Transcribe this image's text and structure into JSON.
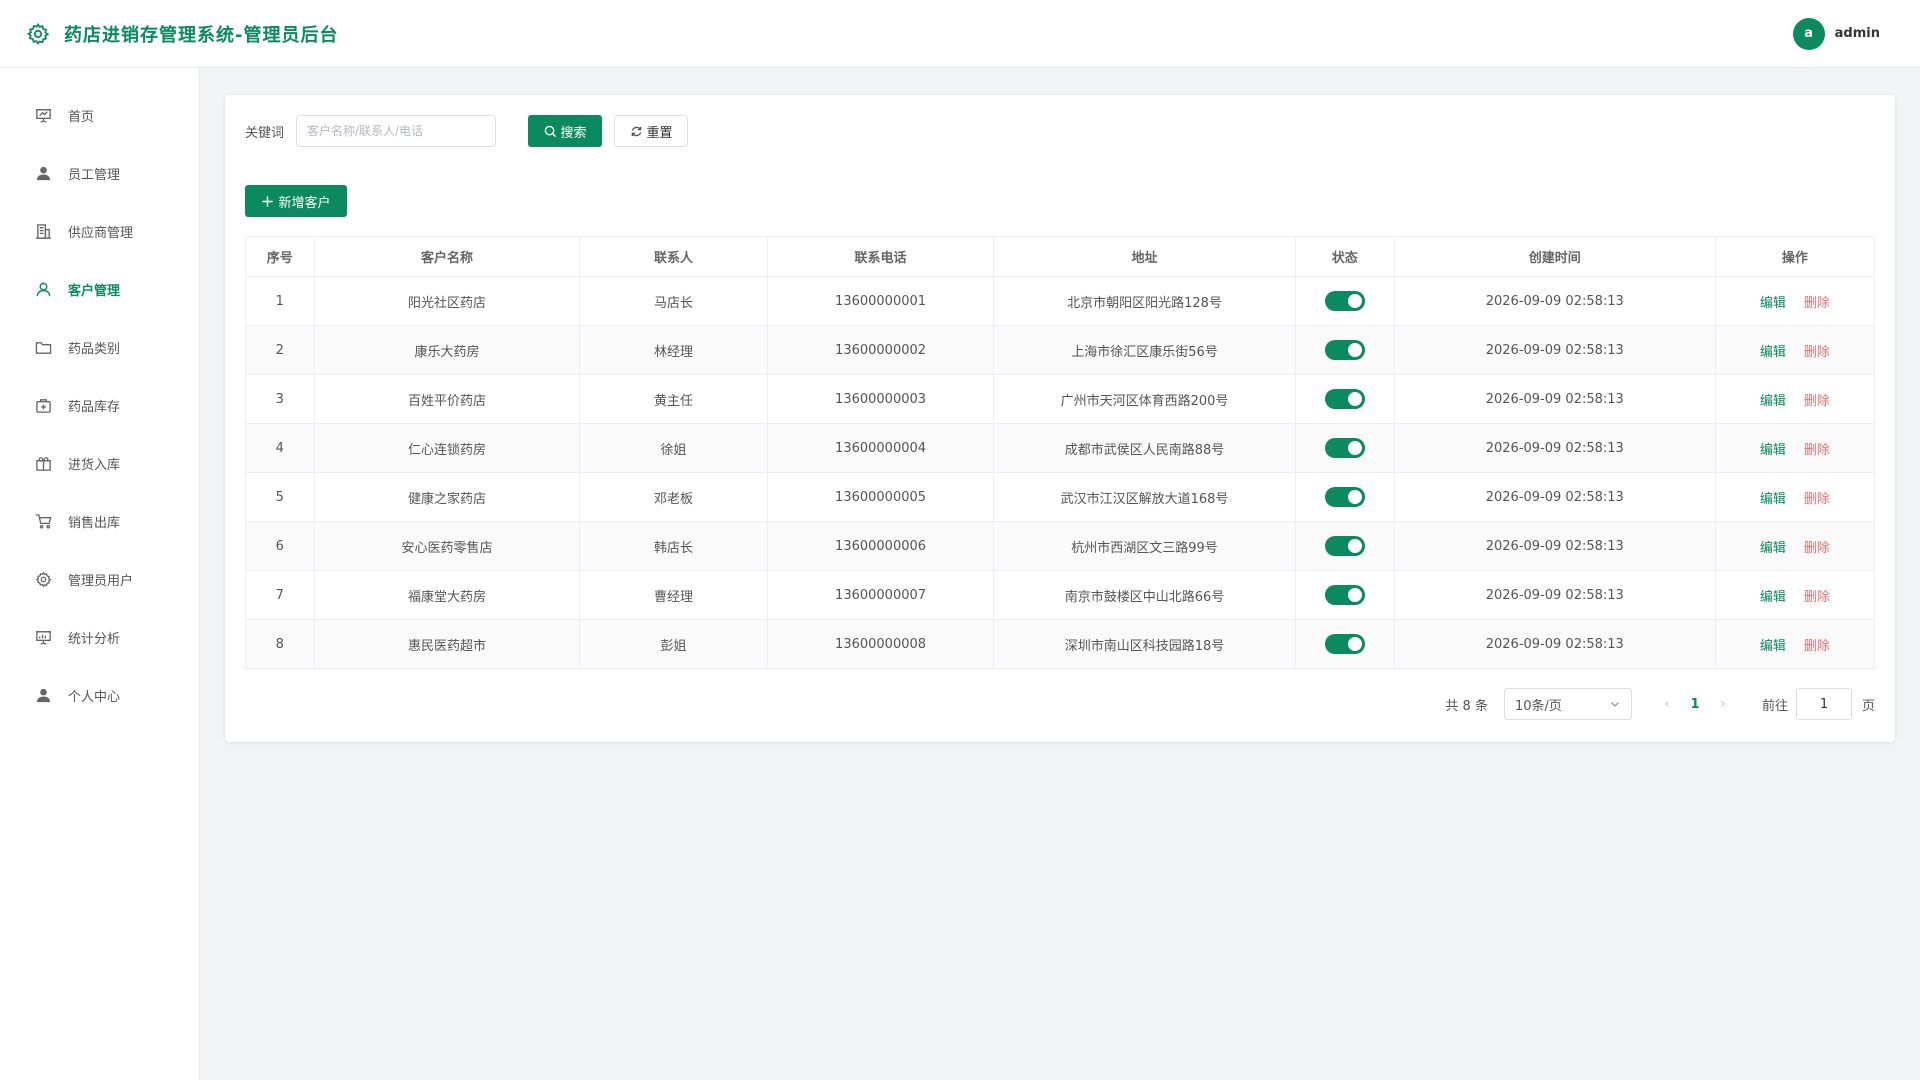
{
  "header": {
    "title": "药店进销存管理系统-管理员后台",
    "user": {
      "avatar_letter": "a",
      "name": "admin"
    }
  },
  "sidebar": {
    "items": [
      {
        "label": "首页",
        "icon": "presentation-icon",
        "active": false
      },
      {
        "label": "员工管理",
        "icon": "user-filled-icon",
        "active": false
      },
      {
        "label": "供应商管理",
        "icon": "office-building-icon",
        "active": false
      },
      {
        "label": "客户管理",
        "icon": "user-icon",
        "active": true
      },
      {
        "label": "药品类别",
        "icon": "folder-icon",
        "active": false
      },
      {
        "label": "药品库存",
        "icon": "first-aid-kit-icon",
        "active": false
      },
      {
        "label": "进货入库",
        "icon": "box-icon",
        "active": false
      },
      {
        "label": "销售出库",
        "icon": "shopping-cart-icon",
        "active": false
      },
      {
        "label": "管理员用户",
        "icon": "gear-icon",
        "active": false
      },
      {
        "label": "统计分析",
        "icon": "data-board-icon",
        "active": false
      },
      {
        "label": "个人中心",
        "icon": "user-filled-icon",
        "active": false
      }
    ]
  },
  "filters": {
    "keyword_label": "关键词",
    "keyword_placeholder": "客户名称/联系人/电话",
    "keyword_value": "",
    "search_label": "搜索",
    "reset_label": "重置"
  },
  "toolbar": {
    "add_label": "新增客户"
  },
  "table": {
    "columns": [
      "序号",
      "客户名称",
      "联系人",
      "联系电话",
      "地址",
      "状态",
      "创建时间",
      "操作"
    ],
    "edit_label": "编辑",
    "delete_label": "删除",
    "rows": [
      {
        "no": "1",
        "name": "阳光社区药店",
        "contact": "马店长",
        "phone": "13600000001",
        "address": "北京市朝阳区阳光路128号",
        "enabled": true,
        "created": "2026-09-09 02:58:13"
      },
      {
        "no": "2",
        "name": "康乐大药房",
        "contact": "林经理",
        "phone": "13600000002",
        "address": "上海市徐汇区康乐街56号",
        "enabled": true,
        "created": "2026-09-09 02:58:13"
      },
      {
        "no": "3",
        "name": "百姓平价药店",
        "contact": "黄主任",
        "phone": "13600000003",
        "address": "广州市天河区体育西路200号",
        "enabled": true,
        "created": "2026-09-09 02:58:13"
      },
      {
        "no": "4",
        "name": "仁心连锁药房",
        "contact": "徐姐",
        "phone": "13600000004",
        "address": "成都市武侯区人民南路88号",
        "enabled": true,
        "created": "2026-09-09 02:58:13"
      },
      {
        "no": "5",
        "name": "健康之家药店",
        "contact": "邓老板",
        "phone": "13600000005",
        "address": "武汉市江汉区解放大道168号",
        "enabled": true,
        "created": "2026-09-09 02:58:13"
      },
      {
        "no": "6",
        "name": "安心医药零售店",
        "contact": "韩店长",
        "phone": "13600000006",
        "address": "杭州市西湖区文三路99号",
        "enabled": true,
        "created": "2026-09-09 02:58:13"
      },
      {
        "no": "7",
        "name": "福康堂大药房",
        "contact": "曹经理",
        "phone": "13600000007",
        "address": "南京市鼓楼区中山北路66号",
        "enabled": true,
        "created": "2026-09-09 02:58:13"
      },
      {
        "no": "8",
        "name": "惠民医药超市",
        "contact": "彭姐",
        "phone": "13600000008",
        "address": "深圳市南山区科技园路18号",
        "enabled": true,
        "created": "2026-09-09 02:58:13"
      }
    ]
  },
  "pagination": {
    "total_text": "共 8 条",
    "page_size": "10条/页",
    "current_page": "1",
    "goto_label": "前往",
    "goto_value": "1",
    "page_unit": "页"
  },
  "colors": {
    "primary": "#0b8a5f",
    "danger": "#f56c6c"
  }
}
